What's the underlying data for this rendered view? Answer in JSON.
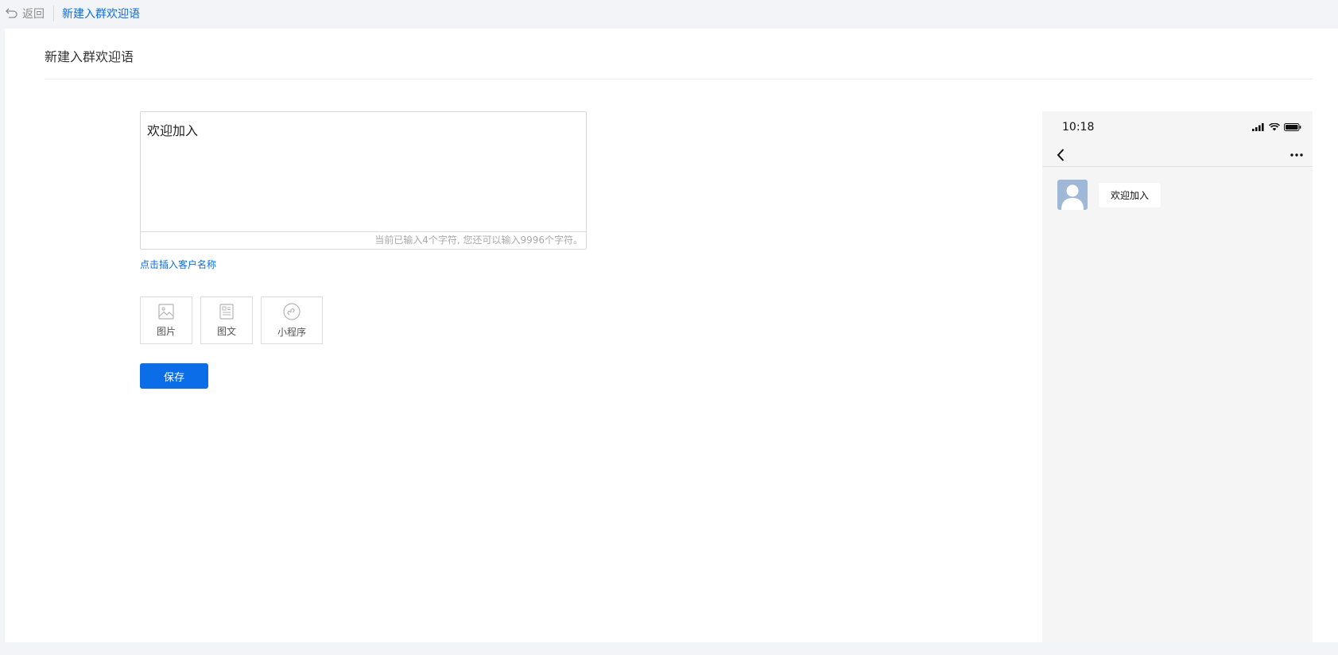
{
  "topbar": {
    "back_label": "返回",
    "breadcrumb": "新建入群欢迎语"
  },
  "page": {
    "title": "新建入群欢迎语"
  },
  "editor": {
    "value": "欢迎加入",
    "counter_text": "当前已输入4个字符, 您还可以输入9996个字符。"
  },
  "insert_customer_name": "点击插入客户名称",
  "attachments": [
    {
      "label": "图片",
      "icon": "image-icon"
    },
    {
      "label": "图文",
      "icon": "article-icon"
    },
    {
      "label": "小程序",
      "icon": "mini-program-icon"
    }
  ],
  "save_label": "保存",
  "preview": {
    "time": "10:18",
    "message": "欢迎加入"
  },
  "colors": {
    "accent": "#0b6de8",
    "avatar_bg": "#9fb8d8"
  }
}
